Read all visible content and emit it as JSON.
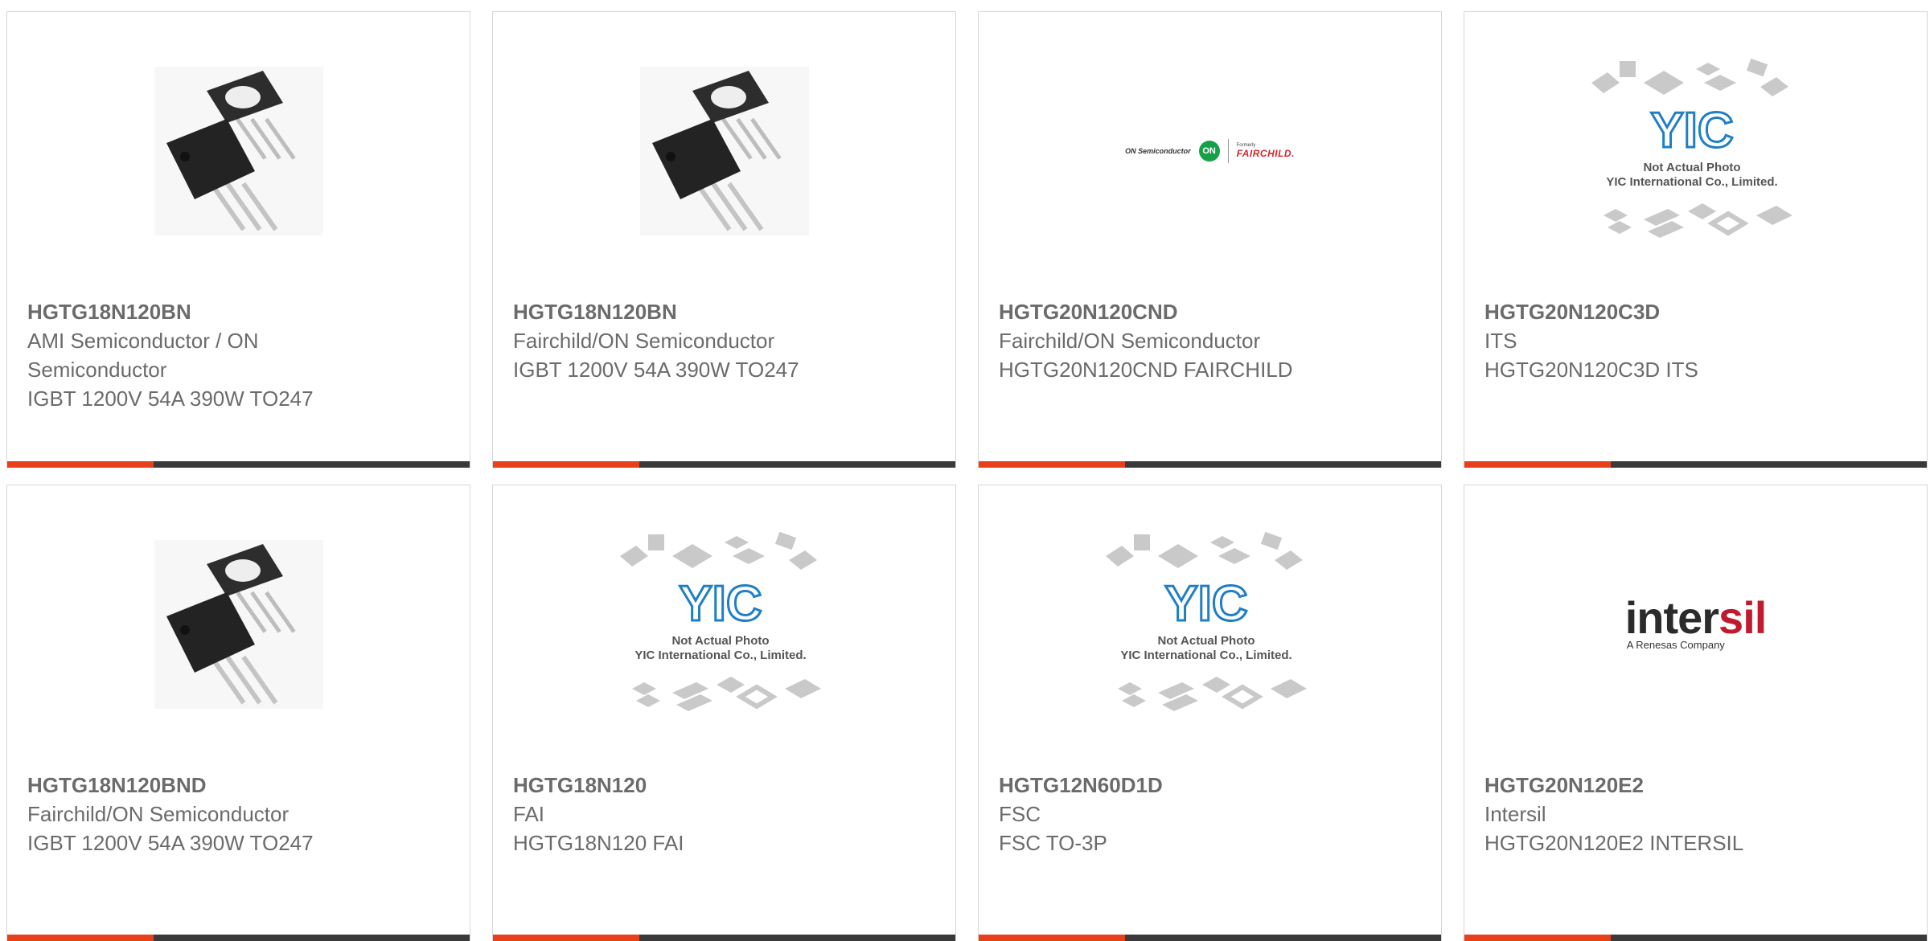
{
  "cards": [
    {
      "part": "HGTG18N120BN",
      "line1": "AMI Semiconductor / ON",
      "line2": "Semiconductor",
      "line3": "IGBT 1200V 54A 390W TO247",
      "image": "photo"
    },
    {
      "part": "HGTG18N120BN",
      "line1": "Fairchild/ON Semiconductor",
      "line2": "IGBT 1200V 54A 390W TO247",
      "line3": "",
      "image": "photo"
    },
    {
      "part": "HGTG20N120CND",
      "line1": "Fairchild/ON Semiconductor",
      "line2": "HGTG20N120CND FAIRCHILD",
      "line3": "",
      "image": "on-fairchild-logo"
    },
    {
      "part": "HGTG20N120C3D",
      "line1": "ITS",
      "line2": "HGTG20N120C3D ITS",
      "line3": "",
      "image": "yic-placeholder"
    },
    {
      "part": "HGTG18N120BND",
      "line1": "Fairchild/ON Semiconductor",
      "line2": "IGBT 1200V 54A 390W TO247",
      "line3": "",
      "image": "photo"
    },
    {
      "part": "HGTG18N120",
      "line1": "FAI",
      "line2": "HGTG18N120 FAI",
      "line3": "",
      "image": "yic-placeholder"
    },
    {
      "part": "HGTG12N60D1D",
      "line1": "FSC",
      "line2": "FSC TO-3P",
      "line3": "",
      "image": "yic-placeholder"
    },
    {
      "part": "HGTG20N120E2",
      "line1": "Intersil",
      "line2": "HGTG20N120E2 INTERSIL",
      "line3": "",
      "image": "intersil-logo"
    }
  ],
  "placeholder": {
    "yic": "YIC",
    "note1": "Not Actual Photo",
    "note2": "YIC International Co., Limited."
  },
  "logos": {
    "on_text": "ON Semiconductor",
    "on_mark": "ON",
    "formerly": "Formerly",
    "fairchild": "FAIRCHILD.",
    "intersil_a": "inter",
    "intersil_b": "sil",
    "intersil_sub": "A Renesas Company"
  },
  "colors": {
    "accent": "#e8401a",
    "bar": "#3a3a3a",
    "text": "#6b6b6b",
    "yic_blue": "#1f7fc4"
  }
}
